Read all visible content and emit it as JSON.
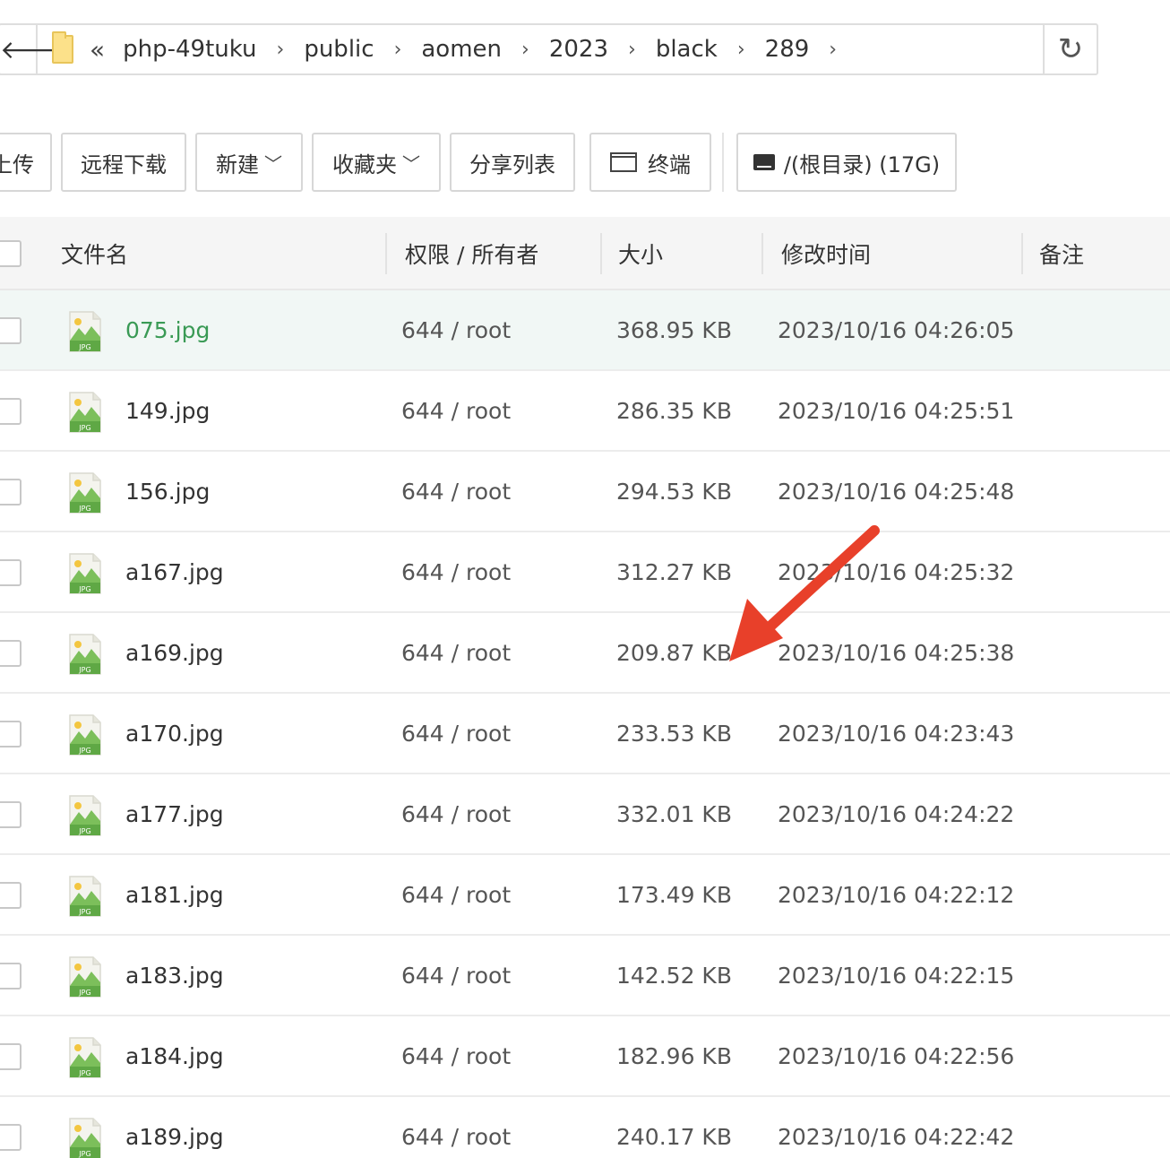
{
  "path_bar": {
    "back_icon": "back-arrow-icon",
    "folder_icon": "folder-icon",
    "collapse_icon": "double-chevron-left-icon",
    "separator": "›",
    "crumbs": [
      "php-49tuku",
      "public",
      "aomen",
      "2023",
      "black",
      "289"
    ],
    "refresh_icon": "refresh-icon"
  },
  "toolbar": {
    "upload_label": "上传",
    "remote_download_label": "远程下载",
    "new_label": "新建",
    "favorites_label": "收藏夹",
    "share_list_label": "分享列表",
    "terminal_label": "终端",
    "disk_label": "/(根目录) (17G)"
  },
  "table": {
    "headers": {
      "name": "文件名",
      "perm_owner": "权限 / 所有者",
      "size": "大小",
      "modified": "修改时间",
      "note": "备注"
    },
    "rows": [
      {
        "name": "075.jpg",
        "perm": "644 / root",
        "size": "368.95 KB",
        "mtime": "2023/10/16 04:26:05"
      },
      {
        "name": "149.jpg",
        "perm": "644 / root",
        "size": "286.35 KB",
        "mtime": "2023/10/16 04:25:51"
      },
      {
        "name": "156.jpg",
        "perm": "644 / root",
        "size": "294.53 KB",
        "mtime": "2023/10/16 04:25:48"
      },
      {
        "name": "a167.jpg",
        "perm": "644 / root",
        "size": "312.27 KB",
        "mtime": "2023/10/16 04:25:32"
      },
      {
        "name": "a169.jpg",
        "perm": "644 / root",
        "size": "209.87 KB",
        "mtime": "2023/10/16 04:25:38"
      },
      {
        "name": "a170.jpg",
        "perm": "644 / root",
        "size": "233.53 KB",
        "mtime": "2023/10/16 04:23:43"
      },
      {
        "name": "a177.jpg",
        "perm": "644 / root",
        "size": "332.01 KB",
        "mtime": "2023/10/16 04:24:22"
      },
      {
        "name": "a181.jpg",
        "perm": "644 / root",
        "size": "173.49 KB",
        "mtime": "2023/10/16 04:22:12"
      },
      {
        "name": "a183.jpg",
        "perm": "644 / root",
        "size": "142.52 KB",
        "mtime": "2023/10/16 04:22:15"
      },
      {
        "name": "a184.jpg",
        "perm": "644 / root",
        "size": "182.96 KB",
        "mtime": "2023/10/16 04:22:56"
      },
      {
        "name": "a189.jpg",
        "perm": "644 / root",
        "size": "240.17 KB",
        "mtime": "2023/10/16 04:22:42"
      }
    ],
    "file_icon": "jpg-file-icon",
    "file_icon_text": "JPG",
    "highlighted_row": 0
  },
  "colors": {
    "highlight_row_bg": "#f1f7f5",
    "highlight_text": "#3a9a55",
    "annotation_arrow": "#e8402a",
    "jpg_icon_green": "#5fa845"
  }
}
